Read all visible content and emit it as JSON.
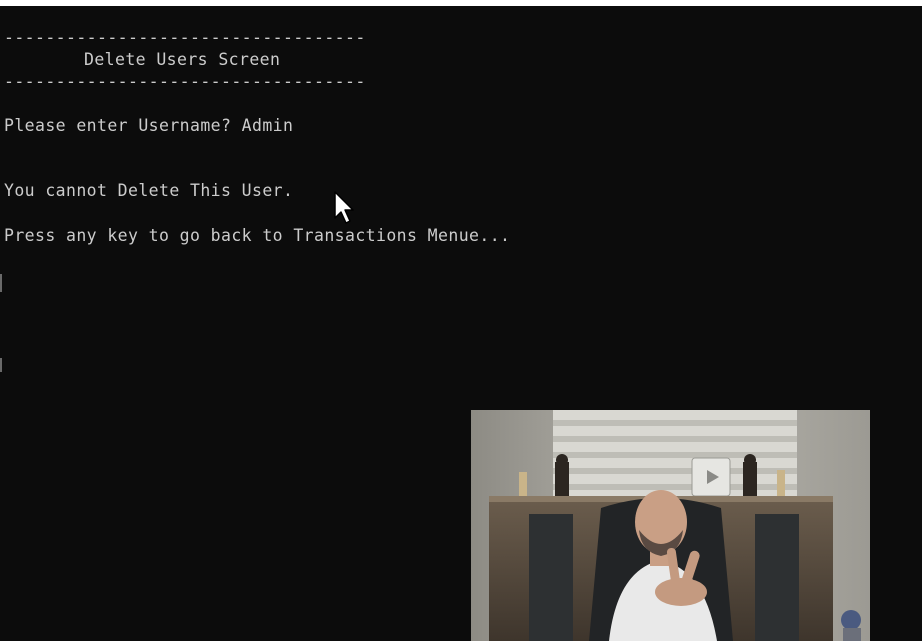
{
  "console": {
    "separator_top": "-----------------------------------",
    "title": "Delete Users Screen",
    "separator_bottom": "-----------------------------------",
    "prompt": "Please enter Username? Admin",
    "message": "You cannot Delete This User.",
    "press_key": "Press any key to go back to Transactions Menue..."
  },
  "colors": {
    "background": "#0c0c0c",
    "text": "#cccccc"
  },
  "icons": {
    "cursor": "mouse-pointer-icon",
    "webcam": "webcam-overlay"
  }
}
